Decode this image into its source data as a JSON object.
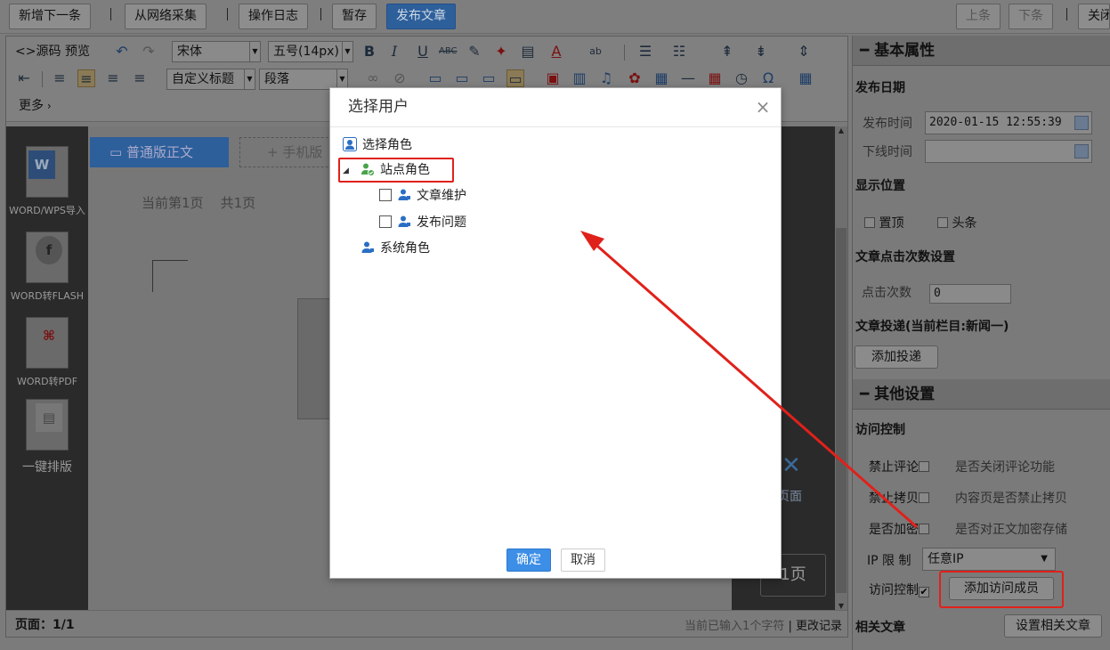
{
  "topbar": {
    "new_next": "新增下一条",
    "web_collect": "从网络采集",
    "op_log": "操作日志",
    "save_draft": "暂存",
    "publish": "发布文章",
    "prev": "上条",
    "next": "下条",
    "close": "关闭"
  },
  "editor": {
    "source": "源码",
    "preview": "预览",
    "font_family": "宋体",
    "font_size": "五号(14px)",
    "custom_title": "自定义标题",
    "paragraph": "段落",
    "more": "更多",
    "side": {
      "word_import": "WORD/WPS导入",
      "word_flash": "WORD转FLASH",
      "word_pdf": "WORD转PDF",
      "one_click": "一键排版"
    },
    "tab_normal": "普通版正文",
    "tab_mobile": "手机版",
    "page_info": "当前第1页    共1页",
    "right_btn1": "页面",
    "right_btn2": "1页",
    "status_page": "页面：1/1",
    "status_chars": "当前已输入1个字符",
    "status_change": "更改记录"
  },
  "props": {
    "basic_title": "基本属性",
    "publish_date": "发布日期",
    "publish_time_label": "发布时间",
    "publish_time_value": "2020-01-15 12:55:39",
    "offline_time_label": "下线时间",
    "display_pos": "显示位置",
    "pin_top": "置顶",
    "headline": "头条",
    "click_setting": "文章点击次数设置",
    "click_count_label": "点击次数",
    "click_count_value": "0",
    "delivery": "文章投递(当前栏目:新闻一)",
    "add_delivery": "添加投递",
    "other_title": "其他设置",
    "access_control": "访问控制",
    "no_comment": "禁止评论",
    "no_comment_desc": "是否关闭评论功能",
    "no_copy": "禁止拷贝",
    "no_copy_desc": "内容页是否禁止拷贝",
    "encrypt": "是否加密",
    "encrypt_desc": "是否对正文加密存储",
    "ip_limit": "IP 限 制",
    "ip_value": "任意IP",
    "access_label": "访问控制",
    "add_member": "添加访问成员",
    "related": "相关文章",
    "set_related": "设置相关文章"
  },
  "modal": {
    "title": "选择用户",
    "root": "选择角色",
    "site_role": "站点角色",
    "child1": "文章维护",
    "child2": "发布问题",
    "system_role": "系统角色",
    "ok": "确定",
    "cancel": "取消"
  },
  "colors": {
    "accent": "#3c8ee6",
    "highlight": "#e0211a"
  }
}
